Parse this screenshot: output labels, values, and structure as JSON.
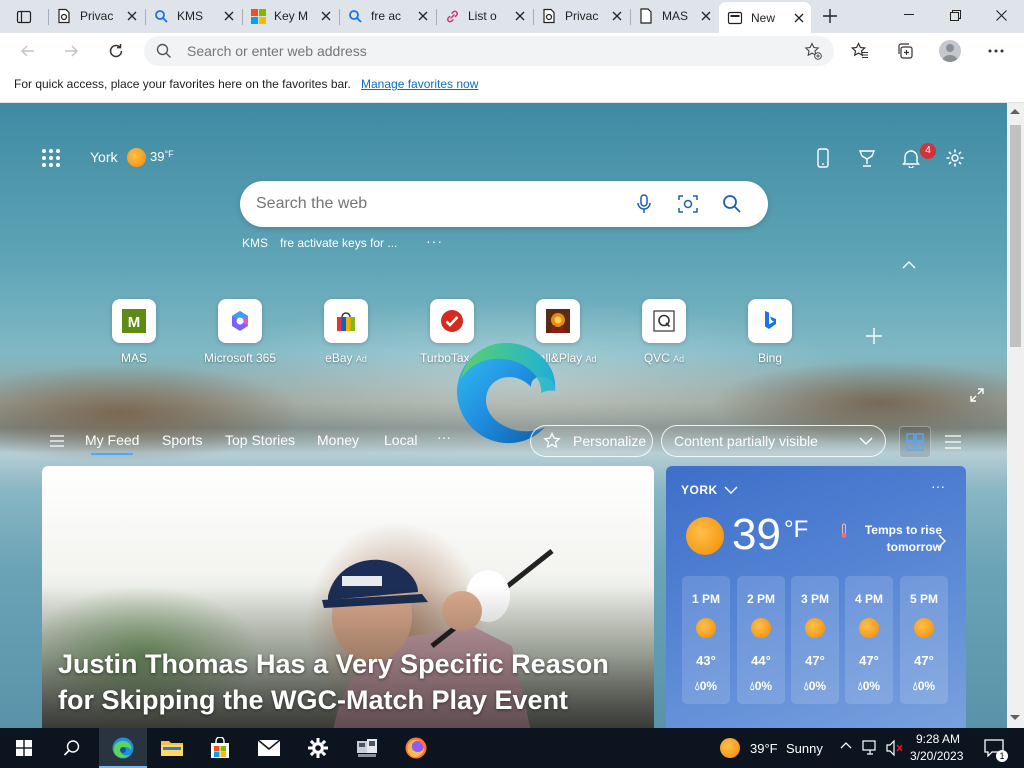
{
  "tabs": [
    {
      "title": "Privac",
      "icon": "privacy-page-icon"
    },
    {
      "title": "KMS",
      "icon": "search-icon"
    },
    {
      "title": "Key M",
      "icon": "microsoft-logo-icon"
    },
    {
      "title": "fre ac",
      "icon": "search-icon"
    },
    {
      "title": "List o",
      "icon": "link-icon"
    },
    {
      "title": "Privac",
      "icon": "privacy-page-icon"
    },
    {
      "title": "MAS",
      "icon": "page-icon"
    },
    {
      "title": "New",
      "icon": "newtab-icon",
      "active": true
    }
  ],
  "address_bar": {
    "placeholder": "Search or enter web address"
  },
  "favorites_bar": {
    "message": "For quick access, place your favorites here on the favorites bar.",
    "link": "Manage favorites now"
  },
  "ntp": {
    "location": "York",
    "temperature": "39",
    "temp_unit": "°F",
    "notification_count": "4",
    "search_placeholder": "Search the web",
    "recent_searches": [
      "KMS",
      "fre activate keys for ..."
    ],
    "more": "···",
    "quick_links": [
      {
        "label": "MAS",
        "ad": "",
        "icon": "mas-icon"
      },
      {
        "label": "Microsoft 365",
        "ad": "",
        "icon": "m365-icon"
      },
      {
        "label": "eBay",
        "ad": "Ad",
        "icon": "ebay-icon"
      },
      {
        "label": "TurboTax",
        "ad": "Ad",
        "icon": "turbotax-icon"
      },
      {
        "label": "Install&Play",
        "ad": "Ad",
        "icon": "installplay-icon"
      },
      {
        "label": "QVC",
        "ad": "Ad",
        "icon": "qvc-icon"
      },
      {
        "label": "Bing",
        "ad": "",
        "icon": "bing-icon"
      }
    ]
  },
  "feed": {
    "tabs": [
      "My Feed",
      "Sports",
      "Top Stories",
      "Money",
      "Local"
    ],
    "more": "···",
    "personalize": "Personalize",
    "content_setting": "Content partially visible",
    "article_headline": "Justin Thomas Has a Very Specific Reason for Skipping the WGC-Match Play Event"
  },
  "weather_card": {
    "city": "YORK",
    "more": "···",
    "temperature": "39",
    "unit": "°F",
    "note": "Temps to rise tomorrow",
    "hourly": [
      {
        "time": "1 PM",
        "temp": "43°",
        "precip": "0%"
      },
      {
        "time": "2 PM",
        "temp": "44°",
        "precip": "0%"
      },
      {
        "time": "3 PM",
        "temp": "47°",
        "precip": "0%"
      },
      {
        "time": "4 PM",
        "temp": "47°",
        "precip": "0%"
      },
      {
        "time": "5 PM",
        "temp": "47°",
        "precip": "0%"
      }
    ]
  },
  "taskbar": {
    "weather_temp": "39°F",
    "weather_text": "Sunny",
    "time": "9:28 AM",
    "date": "3/20/2023",
    "notification_count": "1"
  },
  "colors": {
    "accent": "#0f6cbd",
    "taskbar": "#0c1420",
    "weather_card": "#4a7bd0",
    "badge": "#d13438"
  }
}
